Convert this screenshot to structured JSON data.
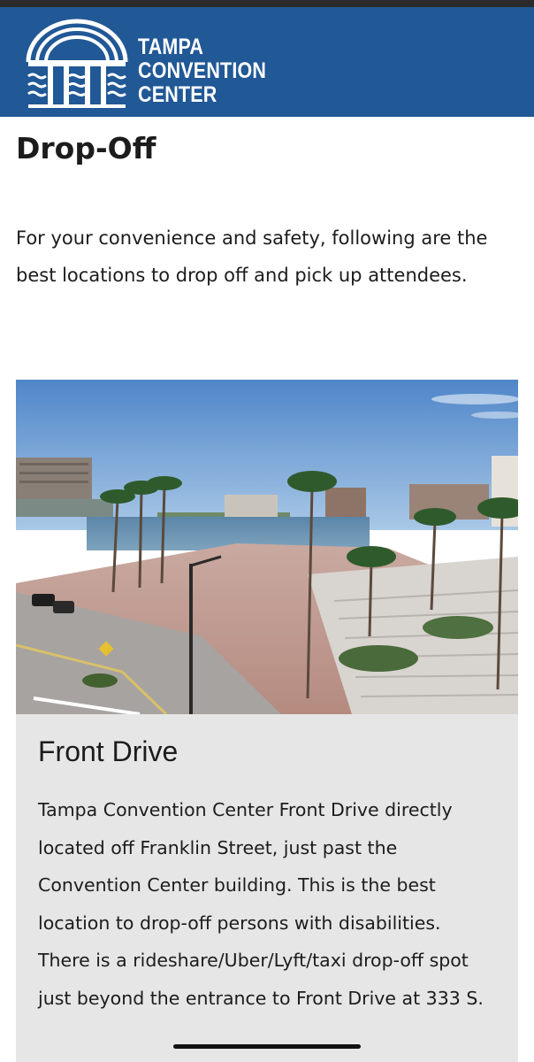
{
  "brand": {
    "logo_lines": [
      "TAMPA",
      "CONVENTION",
      "CENTER"
    ],
    "header_color": "#215896"
  },
  "page": {
    "title": "Drop-Off",
    "intro": "For your convenience and safety, following are the best locations to drop off and pick up attendees."
  },
  "photo": {
    "description_icon": "photo-image"
  },
  "section": {
    "title": "Front Drive",
    "body": "Tampa Convention Center Front Drive directly located off Franklin Street, just past the Convention Center building. This is the best location to drop-off persons with disabilities. There is a rideshare/Uber/Lyft/taxi drop-off spot just beyond the entrance to Front Drive at 333 S."
  }
}
